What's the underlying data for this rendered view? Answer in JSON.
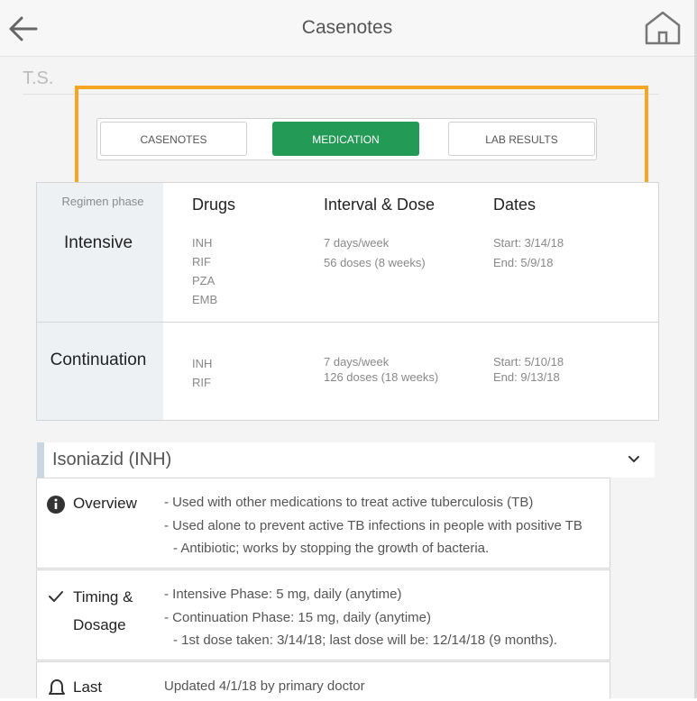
{
  "header": {
    "title": "Casenotes",
    "back_icon": "back-arrow-icon",
    "home_icon": "home-icon"
  },
  "patient": {
    "initials": "T.S."
  },
  "tabs": [
    {
      "label": "CASENOTES",
      "active": false
    },
    {
      "label": "MEDICATION",
      "active": true
    },
    {
      "label": "LAB RESULTS",
      "active": false
    }
  ],
  "colors": {
    "accent": "#239a55",
    "highlight": "#f5a623",
    "drug_bar": "#c9d5df"
  },
  "regimen": {
    "phase_label": "Regimen phase",
    "columns": [
      "Drugs",
      "Interval & Dose",
      "Dates"
    ],
    "phases": [
      {
        "name": "Intensive",
        "drugs": [
          "INH",
          "RIF",
          "PZA",
          "EMB"
        ],
        "interval": [
          "7 days/week",
          "56 doses (8 weeks)"
        ],
        "dates": [
          "Start: 3/14/18",
          "End: 5/9/18"
        ]
      },
      {
        "name": "Continuation",
        "drugs": [
          "INH",
          "RIF"
        ],
        "interval": [
          "7 days/week",
          "126 doses (18 weeks)"
        ],
        "dates": [
          "Start: 5/10/18",
          "End: 9/13/18"
        ]
      }
    ]
  },
  "drug": {
    "name": "Isoniazid (INH)",
    "sections": [
      {
        "title": "Overview",
        "icon": "info-icon",
        "lines": [
          "- Used with other medications to treat active tuberculosis (TB)",
          "- Used alone to prevent active TB infections in people with positive TB",
          "- Antibiotic; works by stopping the growth of bacteria."
        ]
      },
      {
        "title_lines": [
          "Timing &",
          "Dosage"
        ],
        "icon": "check-icon",
        "lines": [
          "- Intensive Phase: 5 mg, daily (anytime)",
          "- Continuation Phase: 15 mg, daily (anytime)",
          "- 1st dose taken: 3/14/18; last dose will be: 12/14/18 (9 months)."
        ]
      },
      {
        "title": "Last",
        "icon": "bell-icon",
        "lines": [
          "Updated 4/1/18 by primary doctor"
        ]
      }
    ]
  }
}
